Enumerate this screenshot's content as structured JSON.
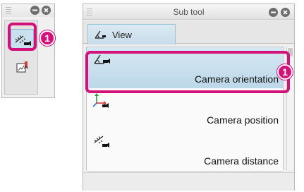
{
  "colors": {
    "highlight": "#d3117b",
    "selected_item": "#bcd7e8",
    "tab_active": "#c7dce9"
  },
  "mini_palette": {
    "icons": [
      "grip-icon",
      "minimize-icon",
      "close-icon",
      "camera-distance-icon",
      "image-tool-icon"
    ],
    "callout_number": "1"
  },
  "subtool_panel": {
    "title": "Sub tool",
    "tab": {
      "label": "View",
      "icon": "camera-orientation-icon"
    },
    "items": [
      {
        "label": "Camera orientation",
        "icon": "camera-orientation-icon",
        "selected": true
      },
      {
        "label": "Camera position",
        "icon": "camera-position-icon",
        "selected": false
      },
      {
        "label": "Camera distance",
        "icon": "camera-distance-icon",
        "selected": false
      }
    ],
    "callout_number": "1"
  }
}
